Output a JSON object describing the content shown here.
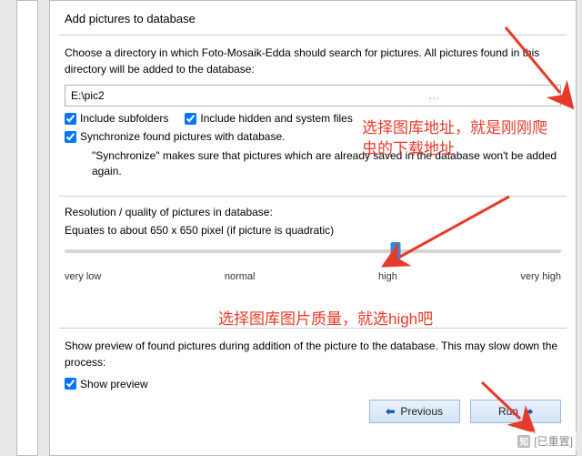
{
  "title": "Add pictures to database",
  "intro": "Choose a directory in which Foto-Mosaik-Edda should search for pictures. All pictures found in this directory will be added to the database:",
  "path_value": "E:\\pic2",
  "browse_dots": "…",
  "chk_subfolders": "Include subfolders",
  "chk_hidden": "Include hidden and system files",
  "chk_sync": "Synchronize found pictures with database.",
  "sync_note": "\"Synchronize\" makes sure that pictures which are already saved in the database won't be added again.",
  "res_heading": "Resolution / quality of pictures in database:",
  "res_equates": "Equates to about 650 x 650 pixel (if picture is quadratic)",
  "slider": {
    "labels": [
      "very low",
      "normal",
      "high",
      "very high"
    ],
    "selected_index": 2
  },
  "preview_heading": "Show preview of found pictures during addition of the picture to the database. This may slow down the process:",
  "chk_preview": "Show preview",
  "btn_prev": "Previous",
  "btn_run": "Run",
  "anno1": "选择图库地址，就是刚刚爬虫的下载地址",
  "anno2": "选择图库图片质量，就选high吧",
  "watermark": "[已重置]"
}
